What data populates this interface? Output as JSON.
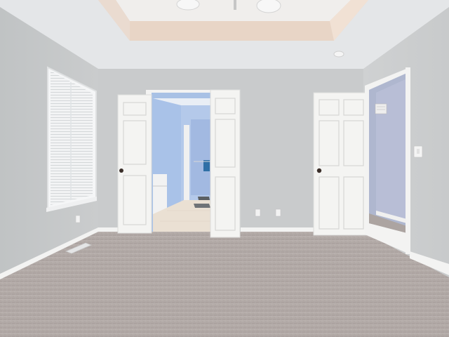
{
  "scene": {
    "description_label": "",
    "palette": {
      "wall": "#c9cbcc",
      "wall_left": "#c2c5c6",
      "wall_right": "#d0d2d3",
      "ceiling": "#e6e8ea",
      "tray_ceiling": "#f1ede9",
      "tray_band": "#e9d6c8",
      "carpet": "#b3aaa8",
      "carpet_dark": "#a49c99",
      "door": "#f4f4f2",
      "door_panel_shadow": "#dcdcdb",
      "trim": "#f3f3f2",
      "bath_blue": "#a9c3e6",
      "bath_blue_dark": "#8fa9d1",
      "hall_wall": "#b5bdd6",
      "knob": "#3b2f2a",
      "window_blind": "#eef0f1",
      "tile_floor": "#e9e0d4"
    },
    "icons": {
      "ceiling_fan": "ceiling-fan-icon",
      "smoke_detector": "smoke-detector-icon",
      "outlet": "electrical-outlet-icon",
      "switch": "light-switch-icon",
      "vent": "air-vent-icon"
    }
  }
}
